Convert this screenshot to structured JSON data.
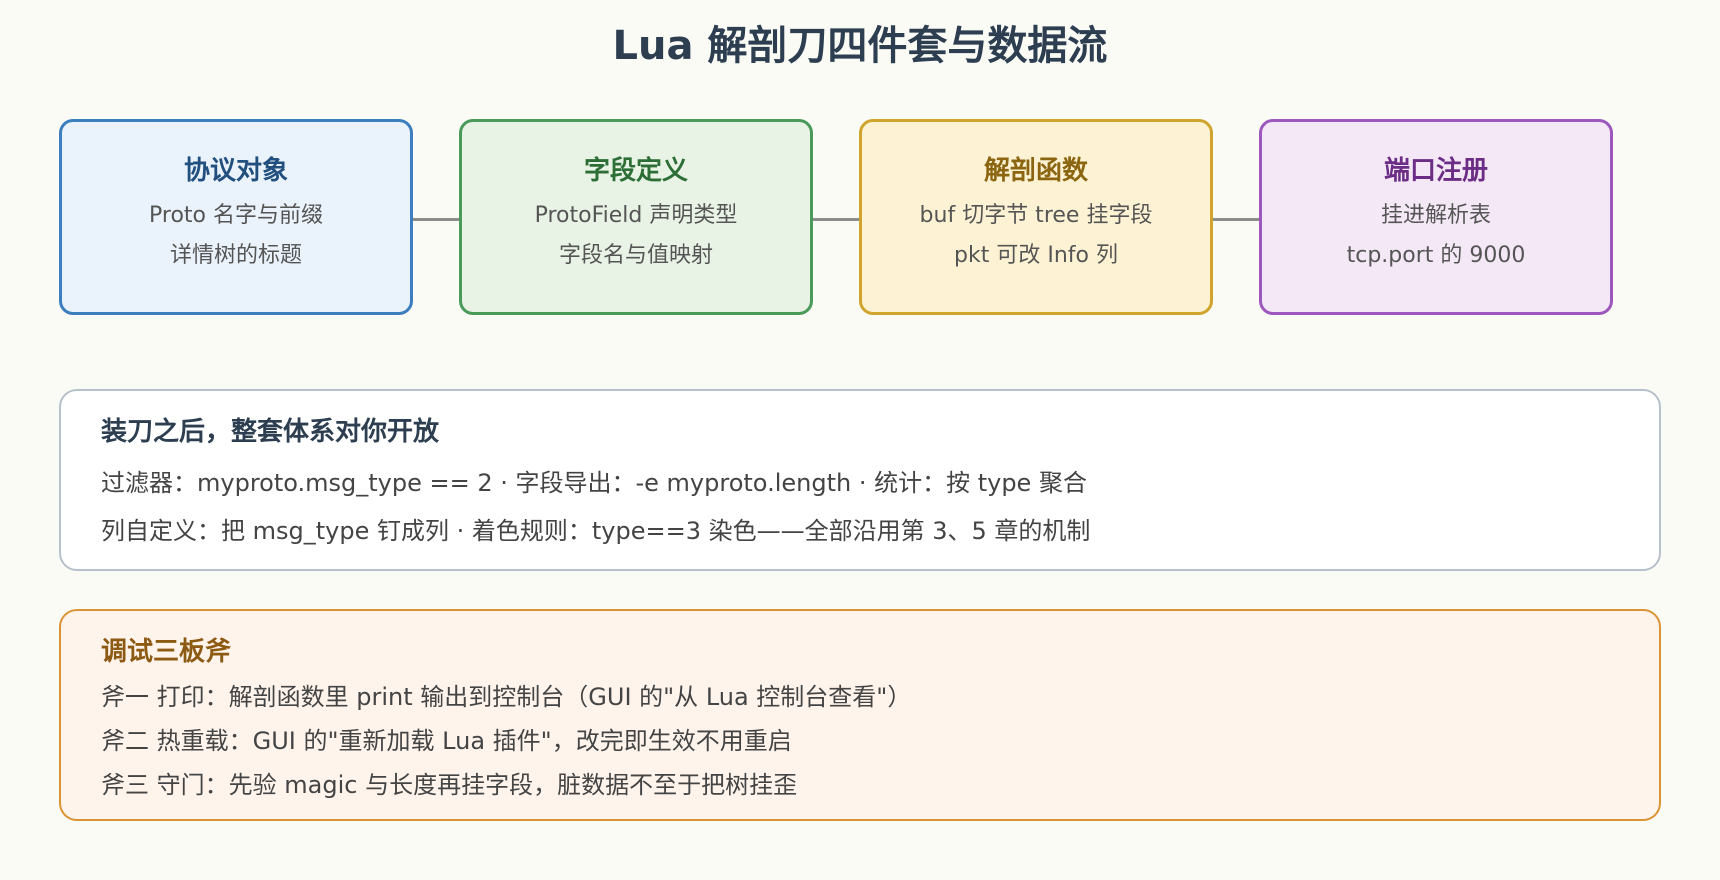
{
  "title": "Lua 解剖刀四件套与数据流",
  "cards": [
    {
      "title": "协议对象",
      "lines": [
        "Proto 名字与前缀",
        "详情树的标题"
      ]
    },
    {
      "title": "字段定义",
      "lines": [
        "ProtoField 声明类型",
        "字段名与值映射"
      ]
    },
    {
      "title": "解剖函数",
      "lines": [
        "buf 切字节 tree 挂字段",
        "pkt 可改 Info 列"
      ]
    },
    {
      "title": "端口注册",
      "lines": [
        "挂进解析表",
        "tcp.port 的 9000"
      ]
    }
  ],
  "ecosystem": {
    "title": "装刀之后，整套体系对你开放",
    "lines": [
      "过滤器：myproto.msg_type == 2 · 字段导出：-e myproto.length · 统计：按 type 聚合",
      "列自定义：把 msg_type 钉成列 · 着色规则：type==3 染色——全部沿用第 3、5 章的机制"
    ]
  },
  "debug": {
    "title": "调试三板斧",
    "lines": [
      "斧一 打印：解剖函数里 print 输出到控制台（GUI 的\"从 Lua 控制台查看\"）",
      "斧二 热重载：GUI 的\"重新加载 Lua 插件\"，改完即生效不用重启",
      "斧三 守门：先验 magic 与长度再挂字段，脏数据不至于把树挂歪"
    ]
  }
}
